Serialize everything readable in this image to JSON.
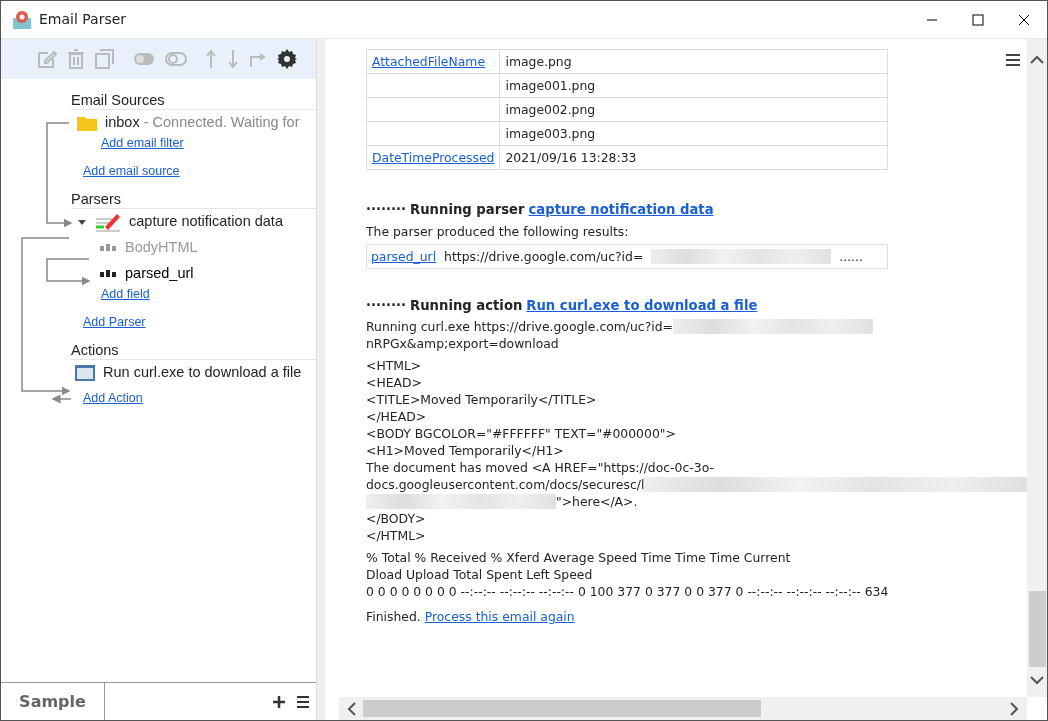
{
  "window": {
    "title": "Email Parser"
  },
  "sidebar": {
    "sections": [
      {
        "kind": "sources",
        "title": "Email Sources",
        "items": [
          {
            "name": "inbox",
            "status": " - Connected. Waiting for",
            "links": [
              "Add email filter"
            ]
          }
        ],
        "add_link": "Add email source"
      },
      {
        "kind": "parsers",
        "title": "Parsers",
        "items": [
          {
            "name": "capture notification data",
            "expanded": true,
            "fields": [
              {
                "name": "BodyHTML",
                "enabled": false
              },
              {
                "name": "parsed_url",
                "enabled": true
              }
            ],
            "links": [
              "Add field"
            ]
          }
        ],
        "add_link": "Add Parser"
      },
      {
        "kind": "actions",
        "title": "Actions",
        "items": [
          {
            "name": "Run curl.exe to download a file"
          }
        ],
        "add_link": "Add Action"
      }
    ]
  },
  "bottom_tabs": [
    {
      "label": "Sample",
      "selected": true
    }
  ],
  "content": {
    "table": {
      "rows": [
        {
          "field": "AttachedFileName",
          "value": "image.png"
        },
        {
          "value": "image001.png"
        },
        {
          "value": "image002.png"
        },
        {
          "value": "image003.png"
        },
        {
          "field": "DateTimeProcessed",
          "value": "2021/09/16 13:28:33"
        }
      ]
    },
    "parser_heading": {
      "dots": "········",
      "label": "Running parser",
      "link": "capture notification data"
    },
    "parser_note": "The parser produced the following results:",
    "results": [
      {
        "field": "parsed_url",
        "value": "https://drive.google.com/uc?id=",
        "tail": "......"
      }
    ],
    "action_heading": {
      "dots": "········",
      "label": "Running action",
      "link": "Run curl.exe to download a file"
    },
    "command": {
      "text": "Running curl.exe https://drive.google.com/uc?id=",
      "rest": "nRPGx&amp;export=download"
    },
    "html_lines": [
      "<HTML>",
      "<HEAD>",
      "<TITLE>Moved Temporarily</TITLE>",
      "</HEAD>",
      "<BODY BGCOLOR=\"#FFFFFF\" TEXT=\"#000000\">",
      "<H1>Moved Temporarily</H1>",
      "The document has moved <A HREF=\"https://doc-0c-3o-",
      "docs.googleusercontent.com/docs/securesc/l",
      "\">here</A>.",
      "</BODY>",
      "</HTML>"
    ],
    "stats_lines": [
      "% Total % Received % Xferd Average Speed Time Time Time Current",
      "Dload Upload Total Spent Left Speed",
      "0 0 0 0 0 0 0 0 --:--:-- --:--:-- --:--:-- 0 100 377 0 377 0 0 377 0 --:--:-- --:--:-- --:--:-- 634"
    ],
    "finished": {
      "text": "Finished.",
      "link": "Process this email again"
    }
  }
}
